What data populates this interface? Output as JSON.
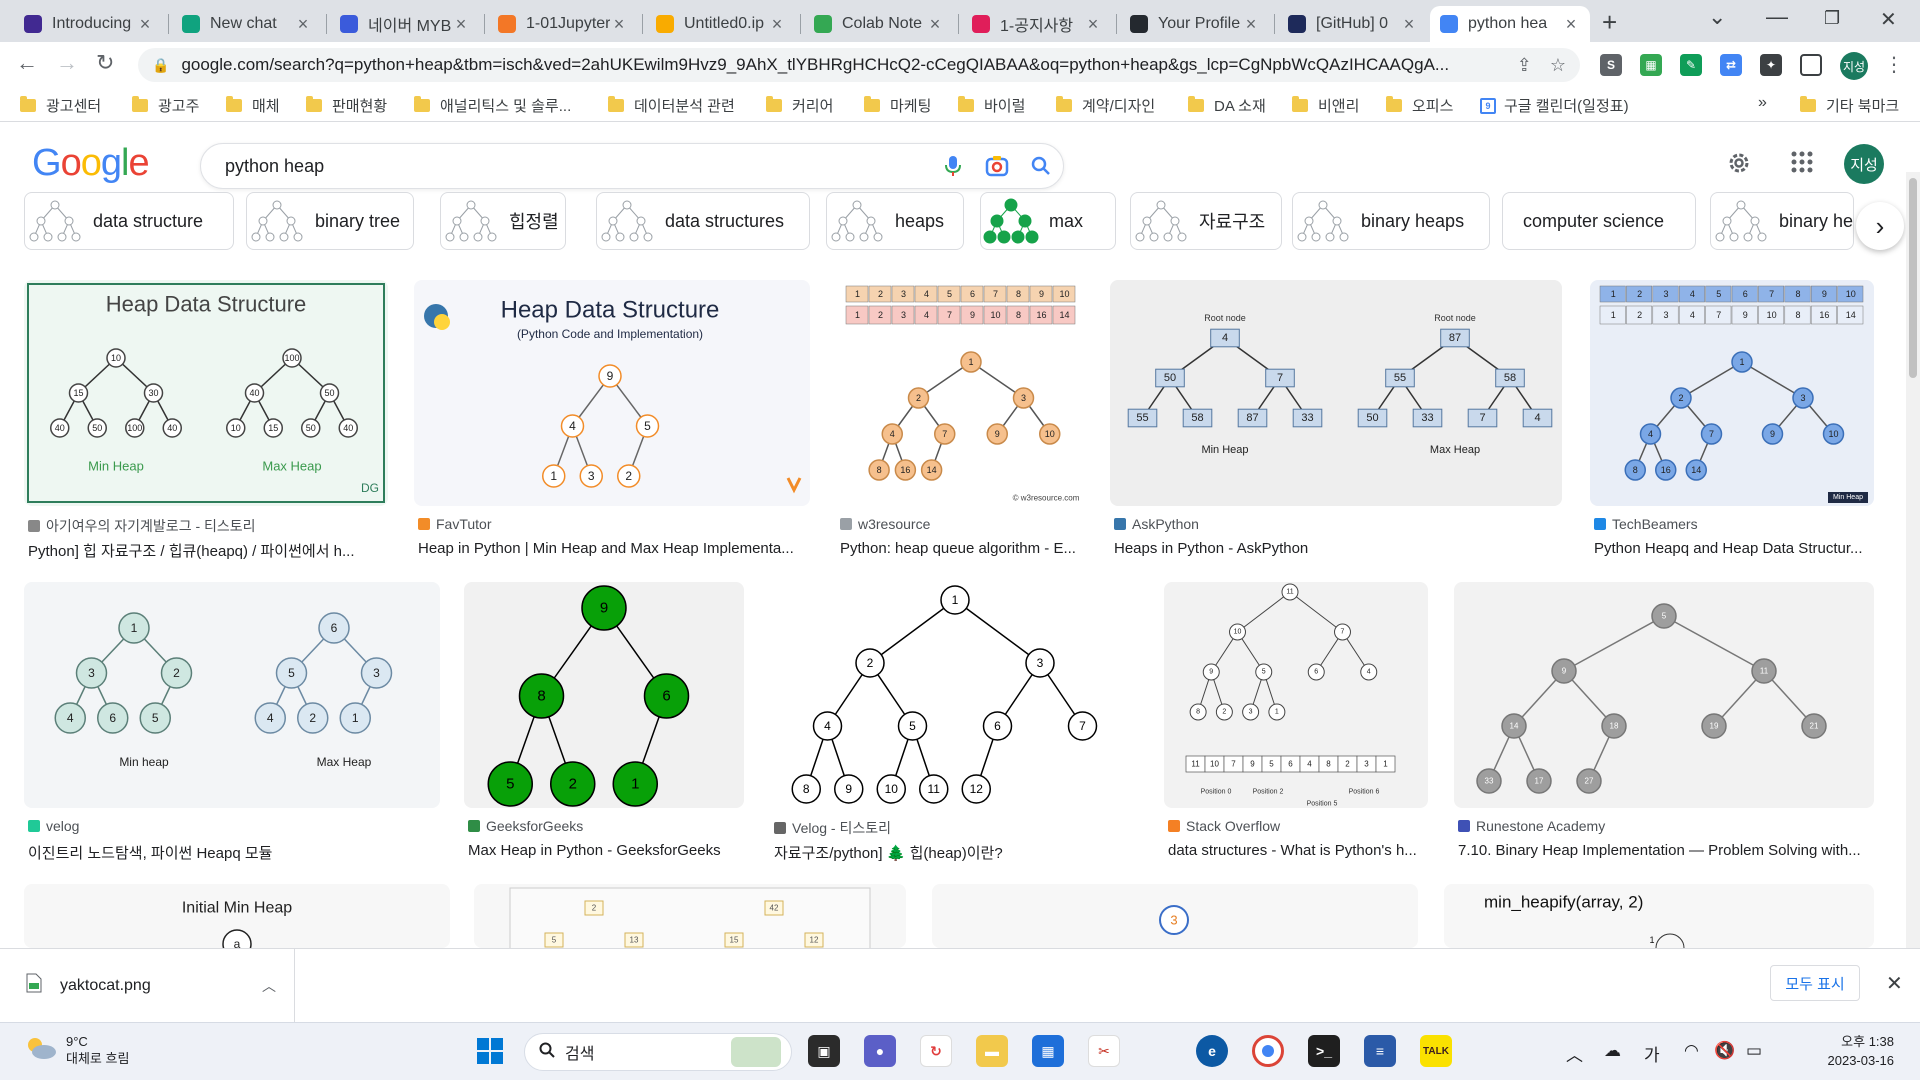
{
  "tabs": [
    {
      "title": "Introducing",
      "icon": "openai-icon",
      "color": "#412991"
    },
    {
      "title": "New chat",
      "icon": "openai-icon",
      "color": "#10a37f"
    },
    {
      "title": "네이버 MYB",
      "icon": "shield-icon",
      "color": "#3b5bdb"
    },
    {
      "title": "1-01Jupyter",
      "icon": "jupyter-icon",
      "color": "#f37726"
    },
    {
      "title": "Untitled0.ip",
      "icon": "colab-icon",
      "color": "#f9ab00"
    },
    {
      "title": "Colab Note",
      "icon": "drive-icon",
      "color": "#34a853"
    },
    {
      "title": "1-공지사항",
      "icon": "slack-icon",
      "color": "#e01e5a"
    },
    {
      "title": "Your Profile",
      "icon": "github-icon",
      "color": "#24292f"
    },
    {
      "title": "[GitHub] 0",
      "icon": "velog-icon",
      "color": "#1e2a5a"
    },
    {
      "title": "python hea",
      "icon": "google-icon",
      "color": "#4285f4"
    }
  ],
  "window": {
    "minimize": "—",
    "maximize": "❐",
    "close": "✕",
    "tab_list": "⌄",
    "new_tab": "+"
  },
  "address_bar": {
    "url": "google.com/search?q=python+heap&tbm=isch&ved=2ahUKEwilm9Hvz9_9AhX_tlYBHRgHCHcQ2-cCegQIABAA&oq=python+heap&gs_lcp=CgNpbWcQAzIHCAAQgA..."
  },
  "profile_initials": "지성",
  "bookmarks": [
    {
      "label": "광고센터"
    },
    {
      "label": "광고주"
    },
    {
      "label": "매체"
    },
    {
      "label": "판매현황"
    },
    {
      "label": "애널리틱스 및 솔루..."
    },
    {
      "label": "데이터분석 관련"
    },
    {
      "label": "커리어"
    },
    {
      "label": "마케팅"
    },
    {
      "label": "바이럴"
    },
    {
      "label": "계약/디자인"
    },
    {
      "label": "DA 소재"
    },
    {
      "label": "비앤리"
    },
    {
      "label": "오피스"
    },
    {
      "label": "구글 캘린더(일정표)"
    }
  ],
  "bookmarks_more": "»",
  "bookmarks_other": "기타 북마크",
  "google": {
    "logo_letters": [
      "G",
      "o",
      "o",
      "g",
      "l",
      "e"
    ],
    "logo_colors": [
      "#4285f4",
      "#ea4335",
      "#fbbc05",
      "#4285f4",
      "#34a853",
      "#ea4335"
    ],
    "query": "python heap"
  },
  "chips": [
    {
      "label": "data structure"
    },
    {
      "label": "binary tree"
    },
    {
      "label": "힙정렬"
    },
    {
      "label": "data structures"
    },
    {
      "label": "heaps"
    },
    {
      "label": "max"
    },
    {
      "label": "자료구조"
    },
    {
      "label": "binary heaps"
    },
    {
      "label": "computer science"
    },
    {
      "label": "binary hea"
    }
  ],
  "results": [
    {
      "source": "아기여우의 자기계발로그 - 티스토리",
      "title": "Python] 힙 자료구조 / 힙큐(heapq) / 파이썬에서 h...",
      "image_title": "Heap Data Structure",
      "captions": [
        "Min Heap",
        "Max Heap"
      ],
      "watermark": "DG",
      "min_nodes": [
        "10",
        "15",
        "30",
        "40",
        "50",
        "100",
        "40"
      ],
      "max_nodes": [
        "100",
        "40",
        "50",
        "10",
        "15",
        "50",
        "40"
      ]
    },
    {
      "source": "FavTutor",
      "title": "Heap in Python | Min Heap and Max Heap Implementa...",
      "image_title": "Heap Data Structure",
      "image_subtitle": "(Python Code and Implementation)",
      "nodes": [
        "9",
        "4",
        "5",
        "1",
        "3",
        "2"
      ]
    },
    {
      "source": "w3resource",
      "title": "Python: heap queue algorithm - E...",
      "row1": [
        "1",
        "2",
        "3",
        "4",
        "5",
        "6",
        "7",
        "8",
        "9",
        "10"
      ],
      "row2": [
        "1",
        "2",
        "3",
        "4",
        "7",
        "9",
        "10",
        "8",
        "16",
        "14"
      ],
      "nodes": [
        "1",
        "2",
        "3",
        "4",
        "7",
        "9",
        "10",
        "8",
        "16",
        "14"
      ],
      "credit": "© w3resource.com"
    },
    {
      "source": "AskPython",
      "title": "Heaps in Python - AskPython",
      "root_label": "Root node",
      "captions": [
        "Min Heap",
        "Max Heap"
      ],
      "min_nodes": [
        "4",
        "50",
        "7",
        "55",
        "58",
        "87",
        "33"
      ],
      "max_nodes": [
        "87",
        "55",
        "58",
        "50",
        "33",
        "7",
        "4"
      ]
    },
    {
      "source": "TechBeamers",
      "title": "Python Heapq and Heap Data Structur...",
      "row1": [
        "1",
        "2",
        "3",
        "4",
        "5",
        "6",
        "7",
        "8",
        "9",
        "10"
      ],
      "row2": [
        "1",
        "2",
        "3",
        "4",
        "7",
        "9",
        "10",
        "8",
        "16",
        "14"
      ],
      "nodes": [
        "1",
        "2",
        "3",
        "4",
        "7",
        "9",
        "10",
        "8",
        "16",
        "14"
      ],
      "badge": "Min Heap"
    },
    {
      "source": "velog",
      "title": "이진트리 노드탐색, 파이썬 Heapq 모듈",
      "captions": [
        "Min heap",
        "Max Heap"
      ],
      "min_nodes": [
        "1",
        "3",
        "2",
        "4",
        "6",
        "5"
      ],
      "max_nodes": [
        "6",
        "5",
        "3",
        "4",
        "2",
        "1"
      ]
    },
    {
      "source": "GeeksforGeeks",
      "title": "Max Heap in Python - GeeksforGeeks",
      "nodes": [
        "9",
        "8",
        "6",
        "5",
        "2",
        "1"
      ]
    },
    {
      "source": "Velog - 티스토리",
      "title": "자료구조/python] 🌲 힙(heap)이란?",
      "nodes": [
        "1",
        "2",
        "3",
        "4",
        "5",
        "6",
        "7",
        "8",
        "9",
        "10",
        "11",
        "12"
      ]
    },
    {
      "source": "Stack Overflow",
      "title": "data structures - What is Python's h...",
      "array": [
        "11",
        "10",
        "7",
        "9",
        "5",
        "6",
        "4",
        "8",
        "2",
        "3",
        "1"
      ],
      "positions": [
        "Position 0",
        "Position 2",
        "Position 5",
        "Position 6"
      ]
    },
    {
      "source": "Runestone Academy",
      "title": "7.10. Binary Heap Implementation — Problem Solving with...",
      "nodes": [
        "5",
        "9",
        "11",
        "14",
        "18",
        "19",
        "21",
        "33",
        "17",
        "27"
      ]
    },
    {
      "image_title": "Initial Min Heap",
      "peek": "a"
    },
    {
      "nodes": [
        "2",
        "42",
        "5",
        "13",
        "15",
        "12"
      ]
    },
    {
      "peek": "3"
    },
    {
      "image_title": "min_heapify(array, 2)",
      "peek": "1"
    }
  ],
  "downloads": {
    "file": "yaktocat.png",
    "show_all": "모두 표시"
  },
  "taskbar": {
    "temp": "9°C",
    "weather": "대체로 흐림",
    "search_placeholder": "검색",
    "time": "오후 1:38",
    "date": "2023-03-16",
    "ime": "가"
  }
}
